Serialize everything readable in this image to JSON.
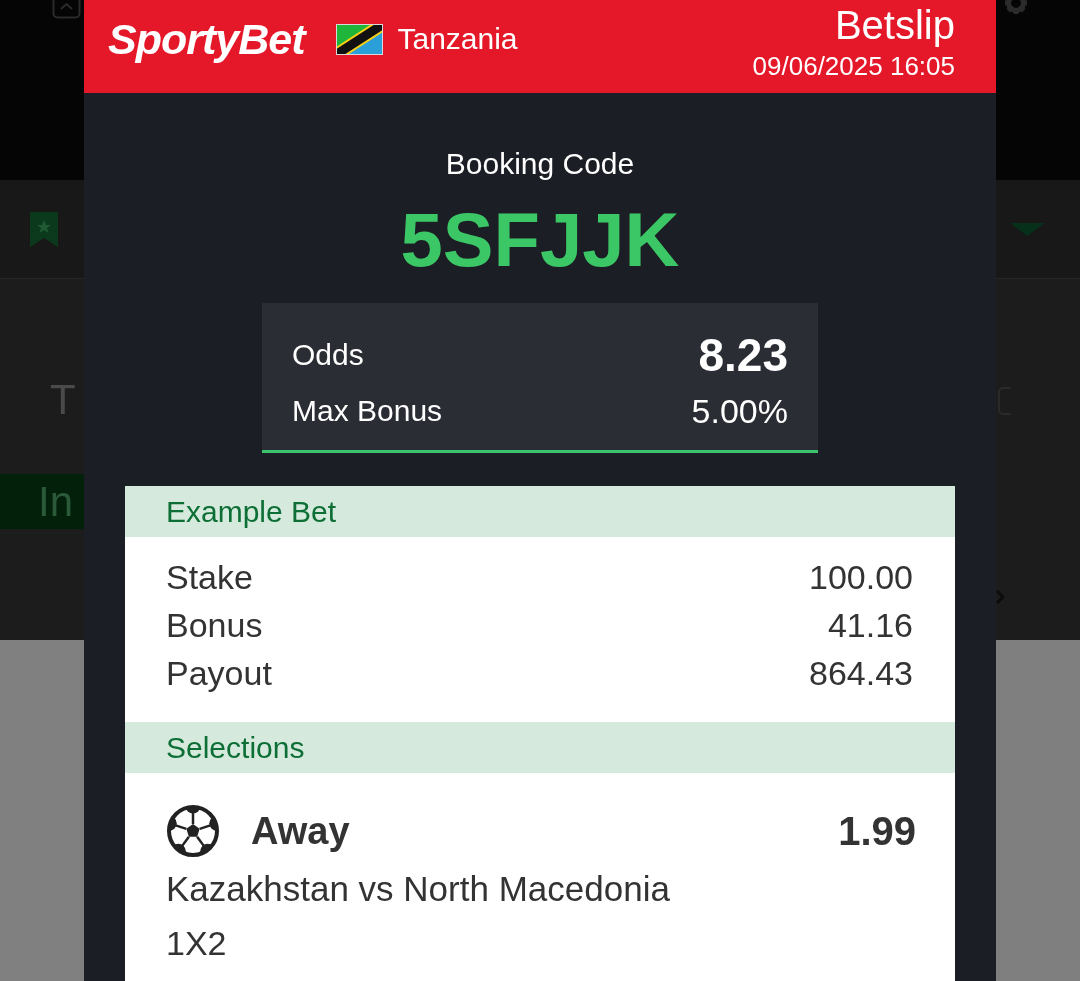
{
  "background": {
    "title_fragment": "T",
    "button_fragment": "In"
  },
  "header": {
    "logo": "SportyBet",
    "country": "Tanzania",
    "title": "Betslip",
    "datetime": "09/06/2025 16:05"
  },
  "booking": {
    "label": "Booking Code",
    "code": "5SFJJK"
  },
  "summary": [
    {
      "kind": "odds",
      "label": "Odds",
      "value": "8.23"
    },
    {
      "kind": "bonus",
      "label": "Max Bonus",
      "value": "5.00%"
    }
  ],
  "example_bet": {
    "title": "Example Bet",
    "rows": [
      {
        "label": "Stake",
        "value": "100.00"
      },
      {
        "label": "Bonus",
        "value": "41.16"
      },
      {
        "label": "Payout",
        "value": "864.43"
      }
    ]
  },
  "selections": {
    "title": "Selections",
    "items": [
      {
        "kind": "football",
        "pick": "Away",
        "odds": "1.99",
        "match": "Kazakhstan vs North Macedonia",
        "market": "1X2"
      }
    ]
  }
}
